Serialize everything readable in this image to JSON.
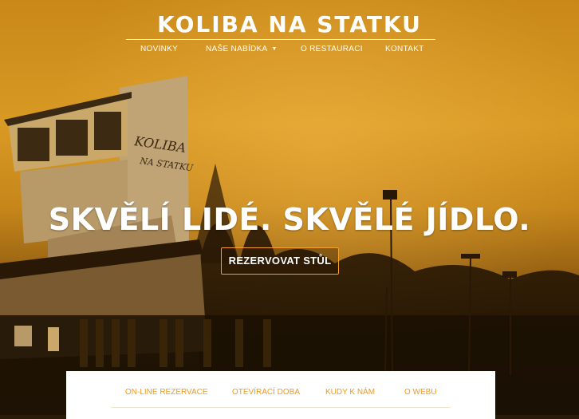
{
  "header": {
    "brand": "KOLIBA NA STATKU",
    "nav": [
      {
        "label": "NOVINKY"
      },
      {
        "label": "NAŠE NABÍDKA",
        "has_dropdown": true
      },
      {
        "label": "O RESTAURACI"
      },
      {
        "label": "KONTAKT"
      }
    ]
  },
  "hero": {
    "headline": "SKVĚLÍ LIDÉ. SKVĚLÉ JÍDLO.",
    "cta_label": "REZERVOVAT STŮL",
    "sign_lines": [
      "KOLIBA",
      "NA STATKU"
    ]
  },
  "info_tabs": [
    {
      "label": "ON-LINE REZERVACE"
    },
    {
      "label": "OTEVÍRACÍ DOBA"
    },
    {
      "label": "KUDY K NÁM"
    },
    {
      "label": "O WEBU"
    }
  ],
  "colors": {
    "accent": "#f09a1c",
    "hero_tint": "#d99a24",
    "text_on_hero": "#ffffff"
  },
  "icons": {
    "dropdown": "caret-down-icon"
  }
}
